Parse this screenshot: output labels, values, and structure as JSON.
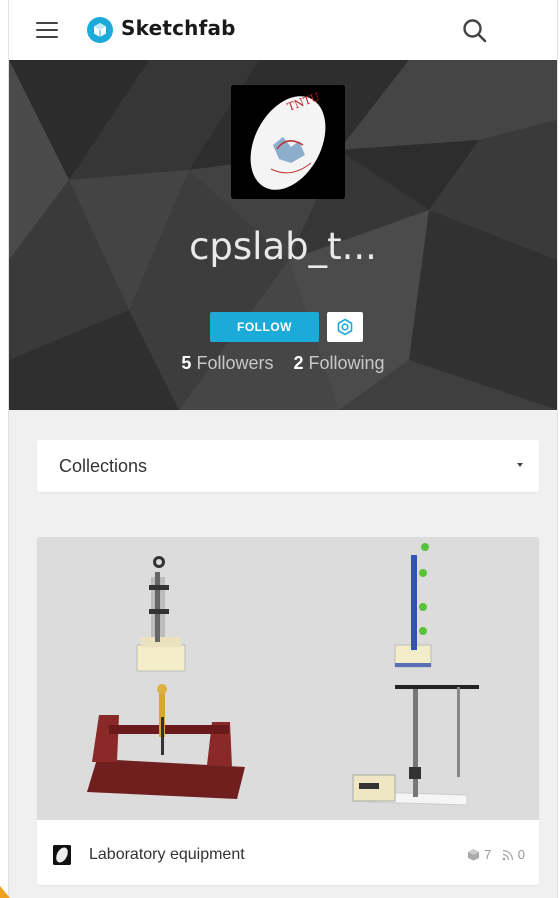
{
  "header": {
    "brand": "Sketchfab",
    "brand_color": "#1caad9"
  },
  "profile": {
    "username": "cpslab_t...",
    "avatar_text": "TNTU",
    "follow_label": "FOLLOW",
    "followers_count": "5",
    "followers_label": "Followers",
    "following_count": "2",
    "following_label": "Following"
  },
  "collections_dropdown": {
    "label": "Collections"
  },
  "collection_card": {
    "title": "Laboratory equipment",
    "models_count": "7",
    "followers_count": "0"
  },
  "icons": [
    "menu-icon",
    "sketchfab-logo-icon",
    "search-icon",
    "settings-icon",
    "chevron-down-icon",
    "model-icon",
    "rss-icon"
  ]
}
